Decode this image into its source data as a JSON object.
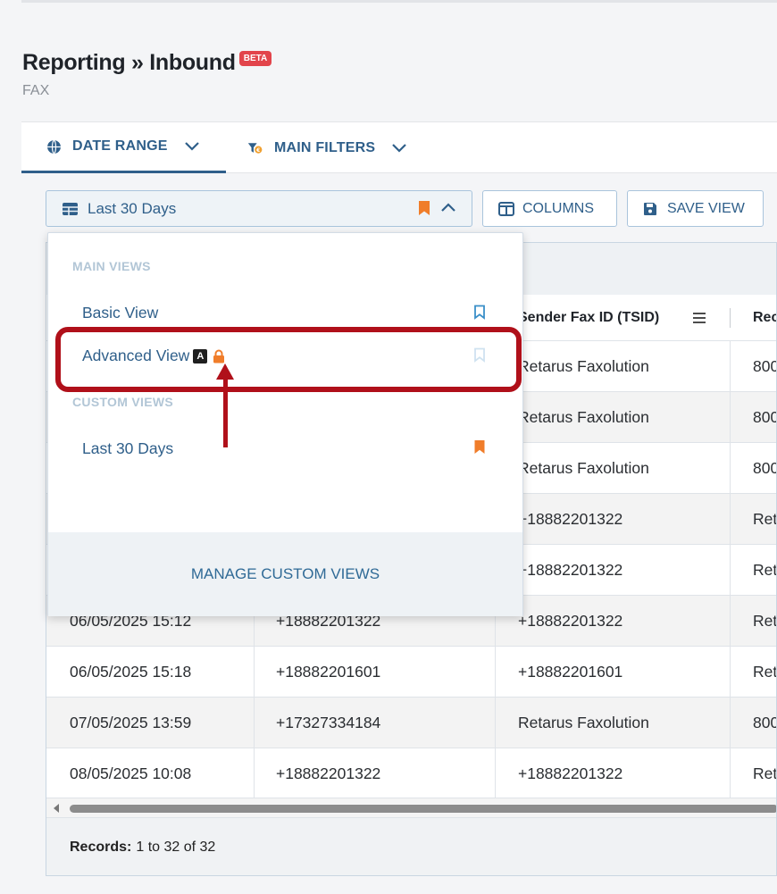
{
  "page": {
    "title": "Reporting » Inbound",
    "beta_badge": "BETA",
    "subtitle": "FAX"
  },
  "tabs": [
    {
      "label": "DATE RANGE",
      "icon": "globe-icon",
      "active": true
    },
    {
      "label": "MAIN FILTERS",
      "icon": "filter-icon",
      "active": false
    }
  ],
  "toolbar": {
    "view_select_label": "Last 30 Days",
    "columns_label": "COLUMNS",
    "save_view_label": "SAVE VIEW"
  },
  "dropdown": {
    "main_views_heading": "MAIN VIEWS",
    "main_views": [
      {
        "label": "Basic View",
        "bookmark": "outline-blue"
      },
      {
        "label": "Advanced View",
        "badge": "A",
        "locked": true,
        "bookmark": "outline-faint"
      }
    ],
    "custom_views_heading": "CUSTOM VIEWS",
    "custom_views": [
      {
        "label": "Last 30 Days",
        "bookmark": "filled-orange"
      }
    ],
    "manage_label": "MANAGE CUSTOM VIEWS"
  },
  "table": {
    "columns": [
      "Sender Fax ID (TSID)",
      "Rec"
    ],
    "rows": [
      {
        "date": "",
        "from": "",
        "tsid": "Retarus Faxolution",
        "rec": "800"
      },
      {
        "date": "",
        "from": "",
        "tsid": "Retarus Faxolution",
        "rec": "800"
      },
      {
        "date": "",
        "from": "",
        "tsid": "Retarus Faxolution",
        "rec": "800"
      },
      {
        "date": "",
        "from": "",
        "tsid": "+18882201322",
        "rec": "Ret"
      },
      {
        "date": "",
        "from": "",
        "tsid": "+18882201322",
        "rec": "Ret"
      },
      {
        "date": "06/05/2025 15:12",
        "from": "+18882201322",
        "tsid": "+18882201322",
        "rec": "Ret"
      },
      {
        "date": "06/05/2025 15:18",
        "from": "+18882201601",
        "tsid": "+18882201601",
        "rec": "Ret"
      },
      {
        "date": "07/05/2025 13:59",
        "from": "+17327334184",
        "tsid": "Retarus Faxolution",
        "rec": "800"
      },
      {
        "date": "08/05/2025 10:08",
        "from": "+18882201322",
        "tsid": "+18882201322",
        "rec": "Ret"
      }
    ],
    "records_label": "Records:",
    "records_value": "1 to 32 of 32"
  },
  "colors": {
    "accent": "#2f5f8a",
    "orange": "#f07d2a",
    "annotation_red": "#b0101a",
    "beta_red": "#e2444b"
  }
}
